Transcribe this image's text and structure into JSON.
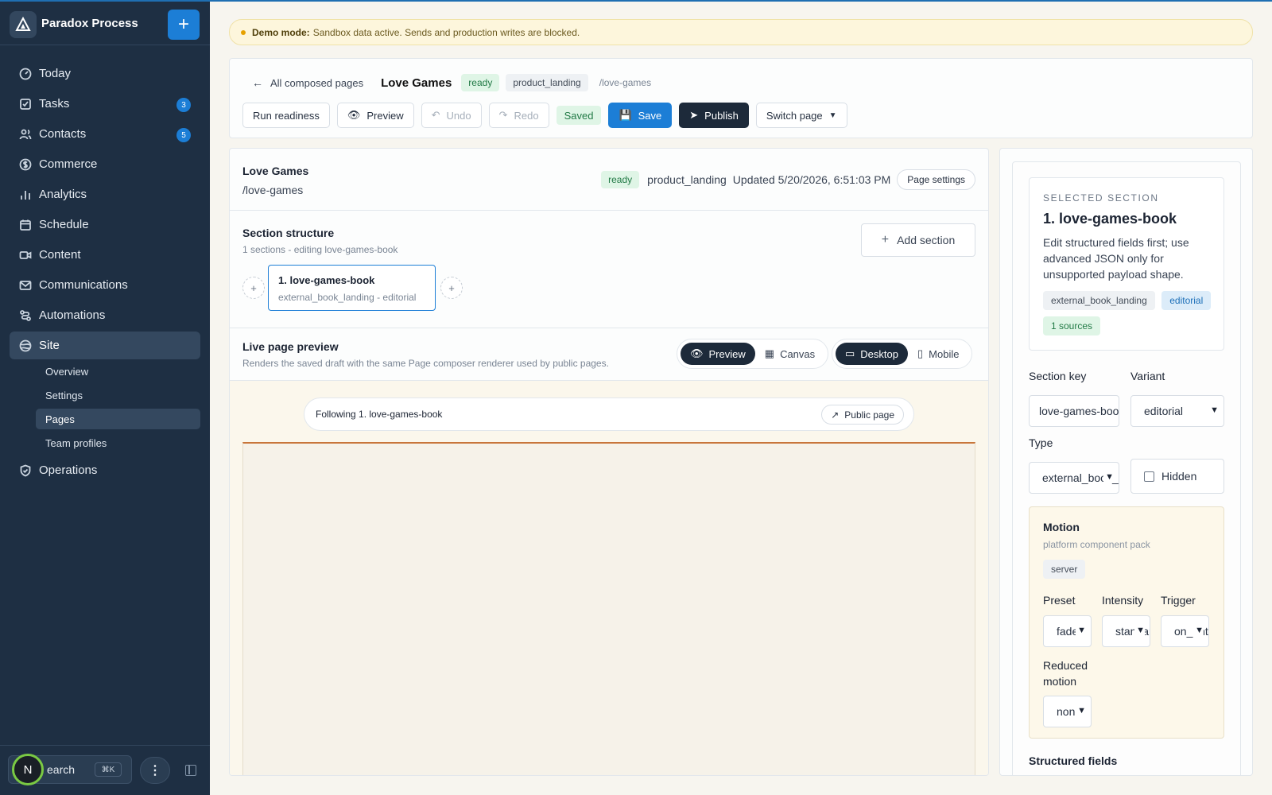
{
  "colors": {
    "sidebar": "#1e2f43",
    "accent": "#1c7ed6",
    "dark_button": "#1d2a3a",
    "ready_green": "#227a46",
    "banner_bg": "#fdf6dc"
  },
  "sidebar": {
    "brand": "Paradox Process",
    "items": [
      {
        "label": "Today",
        "icon": "gauge-icon"
      },
      {
        "label": "Tasks",
        "icon": "checkbox-icon",
        "badge": "3"
      },
      {
        "label": "Contacts",
        "icon": "users-icon",
        "badge": "5"
      },
      {
        "label": "Commerce",
        "icon": "dollar-circle-icon"
      },
      {
        "label": "Analytics",
        "icon": "bar-chart-icon"
      },
      {
        "label": "Schedule",
        "icon": "calendar-icon"
      },
      {
        "label": "Content",
        "icon": "video-icon"
      },
      {
        "label": "Communications",
        "icon": "mail-icon"
      },
      {
        "label": "Automations",
        "icon": "route-icon"
      },
      {
        "label": "Site",
        "icon": "globe-icon"
      },
      {
        "label": "Operations",
        "icon": "shield-icon"
      }
    ],
    "subitems": [
      {
        "label": "Overview"
      },
      {
        "label": "Settings"
      },
      {
        "label": "Pages"
      },
      {
        "label": "Team profiles"
      }
    ],
    "search": {
      "text": "earch",
      "shortcut": "⌘K"
    },
    "avatar": "N"
  },
  "banner": {
    "bold": "Demo mode:",
    "text": "Sandbox data active. Sends and production writes are blocked."
  },
  "header": {
    "back": "All composed pages",
    "title": "Love Games",
    "status": "ready",
    "type": "product_landing",
    "slug": "/love-games",
    "buttons": {
      "run_readiness": "Run readiness",
      "preview": "Preview",
      "undo": "Undo",
      "redo": "Redo",
      "saved": "Saved",
      "save": "Save",
      "publish": "Publish",
      "switch_page": "Switch page"
    }
  },
  "page_info": {
    "title": "Love Games",
    "slug": "/love-games",
    "status": "ready",
    "type": "product_landing",
    "updated": "Updated 5/20/2026, 6:51:03 PM",
    "settings": "Page settings"
  },
  "structure": {
    "title": "Section structure",
    "subtitle": "1 sections - editing love-games-book",
    "add": "Add section",
    "sections": [
      {
        "title": "1. love-games-book",
        "sub": "external_book_landing - editorial"
      }
    ]
  },
  "preview": {
    "title": "Live page preview",
    "subtitle": "Renders the saved draft with the same Page composer renderer used by public pages.",
    "mode_preview": "Preview",
    "mode_canvas": "Canvas",
    "device_desktop": "Desktop",
    "device_mobile": "Mobile",
    "following": "Following 1. love-games-book",
    "public_page": "Public page"
  },
  "selected": {
    "kicker": "SELECTED SECTION",
    "title": "1. love-games-book",
    "description": "Edit structured fields first; use advanced JSON only for unsupported payload shape.",
    "tags": {
      "component": "external_book_landing",
      "variant": "editorial",
      "sources": "1 sources"
    },
    "section_key_label": "Section key",
    "section_key_value": "love-games-book",
    "variant_label": "Variant",
    "variant_value": "editorial",
    "type_label": "Type",
    "type_value": "external_book_landing",
    "hidden_label": "Hidden",
    "motion": {
      "title": "Motion",
      "subtitle": "platform component pack",
      "tag": "server",
      "preset_label": "Preset",
      "preset_value": "fade",
      "intensity_label": "Intensity",
      "intensity_value": "standard",
      "trigger_label": "Trigger",
      "trigger_value": "on_enter",
      "reduced_label": "Reduced motion",
      "reduced_value": "none"
    },
    "structured_fields": "Structured fields"
  }
}
